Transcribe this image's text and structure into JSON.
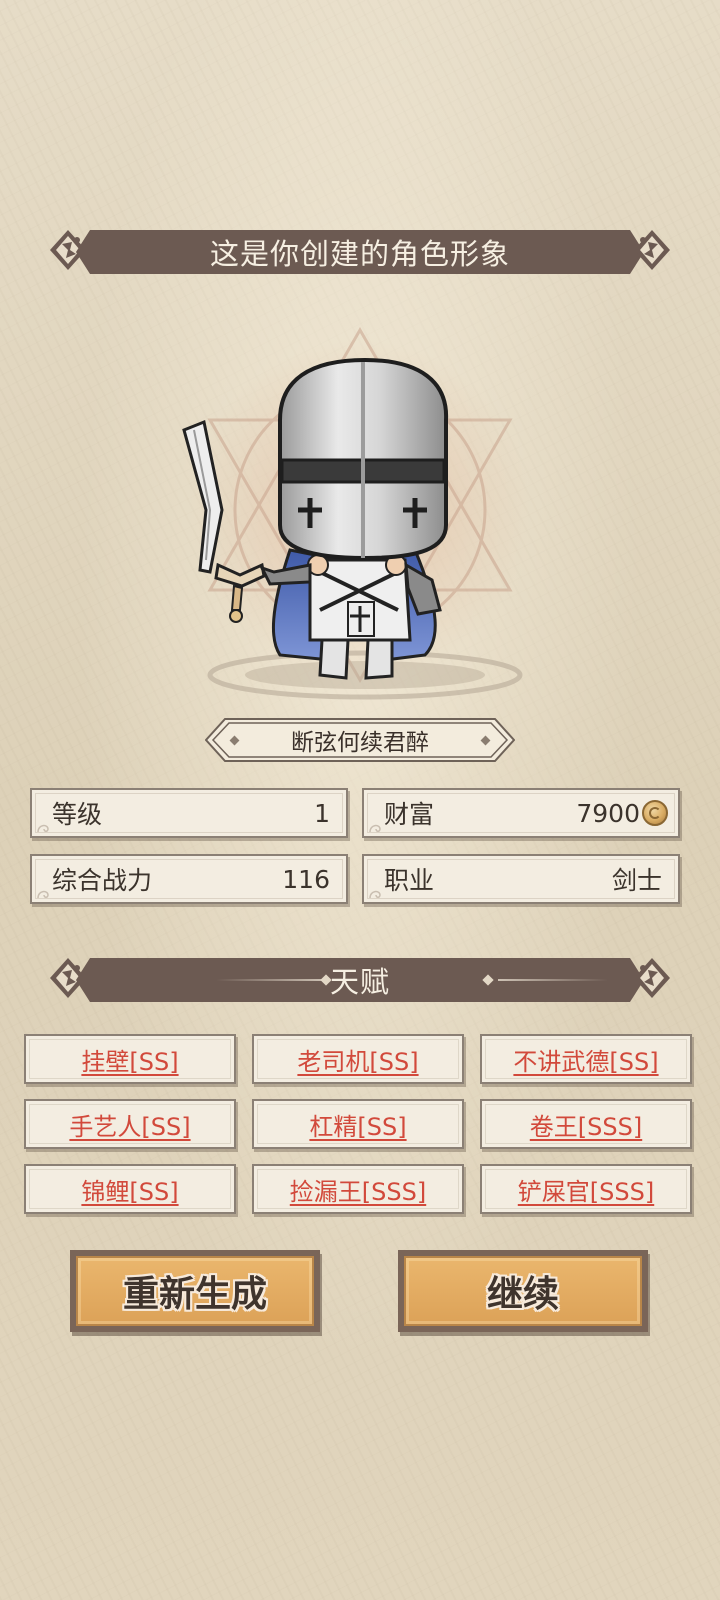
{
  "header": {
    "title": "这是你创建的角色形象"
  },
  "character": {
    "name": "断弦何续君醉"
  },
  "stats": {
    "level": {
      "label": "等级",
      "value": "1"
    },
    "wealth": {
      "label": "财富",
      "value": "7900"
    },
    "power": {
      "label": "综合战力",
      "value": "116"
    },
    "class": {
      "label": "职业",
      "value": "剑士"
    }
  },
  "talents": {
    "title": "天赋",
    "items": [
      "挂壁[SS]",
      "老司机[SS]",
      "不讲武德[SS]",
      "手艺人[SS]",
      "杠精[SS]",
      "卷王[SSS]",
      "锦鲤[SS]",
      "捡漏王[SSS]",
      "铲屎官[SSS]"
    ]
  },
  "actions": {
    "regenerate": "重新生成",
    "continue": "继续"
  },
  "colors": {
    "banner": "#6c5a52",
    "talent_text": "#d2493b",
    "button": "#dca258"
  },
  "icons": {
    "coin": "coin-icon"
  }
}
